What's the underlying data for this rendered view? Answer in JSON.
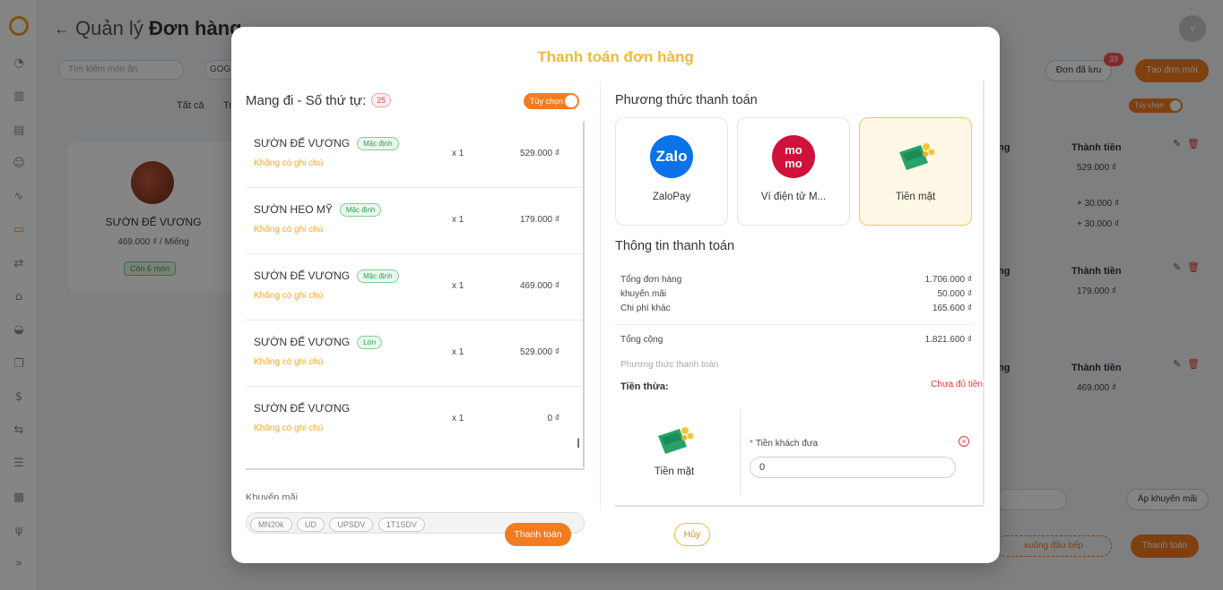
{
  "background": {
    "page_title_prefix": "Quản lý",
    "page_title_main": "Đơn hàng",
    "avatar_initial": "v",
    "search_placeholder": "Tìm kiếm món ăn",
    "filter_chip": "GOG",
    "tab_all": "Tất cả",
    "tab_partial": "Tr",
    "dish": {
      "name": "SƯỜN ĐẾ VƯƠNG",
      "price": "469.000 ₫ / Miếng",
      "stock": "Còn 6 món"
    },
    "saved_orders_label": "Đơn đã lưu",
    "saved_orders_count": "39",
    "new_order_label": "Tạo đơn mới",
    "toggle_label": "Tùy chọn",
    "col_header_partial": "ng",
    "col_total_header": "Thành tiền",
    "rows": [
      {
        "values": [
          "529.000 ₫",
          "+ 30.000 ₫",
          "+ 30.000 ₫"
        ]
      },
      {
        "values": [
          "179.000 ₫"
        ]
      },
      {
        "values": [
          "469.000 ₫"
        ]
      }
    ],
    "apply_promo_label": "Áp khuyến mãi",
    "kitchen_label": "xuống đầu bếp",
    "pay_label": "Thanh toán"
  },
  "modal": {
    "title": "Thanh toán đơn hàng",
    "left": {
      "heading": "Mang đi - Số thứ tự:",
      "order_number": "25",
      "option_toggle": "Tùy chọn",
      "items": [
        {
          "name": "SƯỜN ĐẾ VƯƠNG",
          "tag": "Mặc định",
          "note": "Không có ghi chú",
          "qty": "x 1",
          "price": "529.000 ₫"
        },
        {
          "name": "SƯỜN HEO MỸ",
          "tag": "Mặc định",
          "note": "Không có ghi chú",
          "qty": "x 1",
          "price": "179.000 ₫"
        },
        {
          "name": "SƯỜN ĐẾ VƯƠNG",
          "tag": "Mặc định",
          "note": "Không có ghi chú",
          "qty": "x 1",
          "price": "469.000 ₫"
        },
        {
          "name": "SƯỜN ĐẾ VƯƠNG",
          "tag": "Lớn",
          "note": "Không có ghi chú",
          "qty": "x 1",
          "price": "529.000 ₫"
        },
        {
          "name": "SƯỜN ĐẾ VƯƠNG",
          "tag": "",
          "note": "Không có ghi chú",
          "qty": "x 1",
          "price": "0 ₫"
        }
      ],
      "promo_label": "Khuyến mãi",
      "promo_codes": [
        "MN20k",
        "UD",
        "UPSDV",
        "1T1SDV"
      ]
    },
    "right": {
      "method_title": "Phương thức thanh toán",
      "methods": [
        {
          "name": "ZaloPay",
          "logo_text": "Zalo",
          "selected": false
        },
        {
          "name": "Ví điện tử M...",
          "logo_text": "mo\nmo",
          "selected": false
        },
        {
          "name": "Tiền mặt",
          "logo_text": "",
          "selected": true
        }
      ],
      "info_title": "Thông tin thanh toán",
      "subtotal_label": "Tổng đơn hàng",
      "subtotal": "1.706.000 ₫",
      "discount_label": "khuyến mãi",
      "discount": "50.000 ₫",
      "other_label": "Chi phí khác",
      "other": "165.600 ₫",
      "total_label": "Tổng cộng",
      "total": "1.821.600 ₫",
      "method_muted": "Phương thức thanh toán",
      "change_label": "Tiền thừa:",
      "change_warning": "Chưa đủ tiền",
      "cash_label": "Tiền mặt",
      "given_label": "Tiền khách đưa",
      "given_value": "0"
    },
    "buttons": {
      "pay": "Thanh toán",
      "cancel": "Hủy"
    }
  },
  "colors": {
    "accent": "#f47c20",
    "title": "#f5b73b",
    "tag_green": "#2f9e55",
    "warn": "#e53935"
  }
}
